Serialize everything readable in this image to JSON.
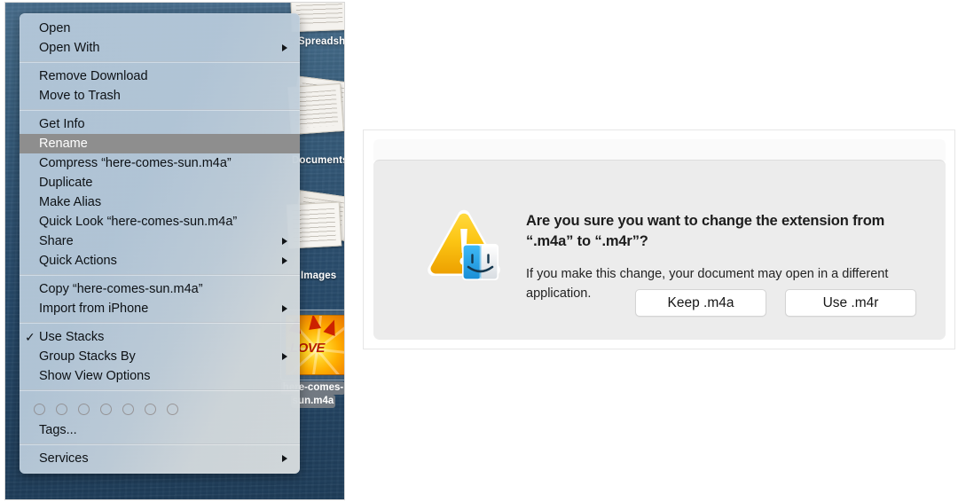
{
  "desktop": {
    "stacks": [
      {
        "label": "Spreadsheets"
      },
      {
        "label": "Documents"
      },
      {
        "label": "Images"
      }
    ],
    "selected_file": {
      "label_line1": "here-comes-",
      "label_line2": "sun.m4a",
      "cover_word": "LOVE"
    }
  },
  "context_menu": {
    "sections": [
      {
        "items": [
          {
            "label": "Open",
            "submenu": false,
            "checked": false,
            "highlighted": false
          },
          {
            "label": "Open With",
            "submenu": true,
            "checked": false,
            "highlighted": false
          }
        ]
      },
      {
        "items": [
          {
            "label": "Remove Download",
            "submenu": false,
            "checked": false,
            "highlighted": false
          },
          {
            "label": "Move to Trash",
            "submenu": false,
            "checked": false,
            "highlighted": false
          }
        ]
      },
      {
        "items": [
          {
            "label": "Get Info",
            "submenu": false,
            "checked": false,
            "highlighted": false
          },
          {
            "label": "Rename",
            "submenu": false,
            "checked": false,
            "highlighted": true
          },
          {
            "label": "Compress “here-comes-sun.m4a”",
            "submenu": false,
            "checked": false,
            "highlighted": false
          },
          {
            "label": "Duplicate",
            "submenu": false,
            "checked": false,
            "highlighted": false
          },
          {
            "label": "Make Alias",
            "submenu": false,
            "checked": false,
            "highlighted": false
          },
          {
            "label": "Quick Look “here-comes-sun.m4a”",
            "submenu": false,
            "checked": false,
            "highlighted": false
          },
          {
            "label": "Share",
            "submenu": true,
            "checked": false,
            "highlighted": false
          },
          {
            "label": "Quick Actions",
            "submenu": true,
            "checked": false,
            "highlighted": false
          }
        ]
      },
      {
        "items": [
          {
            "label": "Copy “here-comes-sun.m4a”",
            "submenu": false,
            "checked": false,
            "highlighted": false
          },
          {
            "label": "Import from iPhone",
            "submenu": true,
            "checked": false,
            "highlighted": false
          }
        ]
      },
      {
        "items": [
          {
            "label": "Use Stacks",
            "submenu": false,
            "checked": true,
            "highlighted": false
          },
          {
            "label": "Group Stacks By",
            "submenu": true,
            "checked": false,
            "highlighted": false
          },
          {
            "label": "Show View Options",
            "submenu": false,
            "checked": false,
            "highlighted": false
          }
        ]
      },
      {
        "tags": {
          "dot_count": 7,
          "label": "Tags..."
        }
      },
      {
        "items": [
          {
            "label": "Services",
            "submenu": true,
            "checked": false,
            "highlighted": false
          }
        ]
      }
    ]
  },
  "dialog": {
    "icon": "warning-triangle-finder-icon",
    "title": "Are you sure you want to change the extension from “.m4a” to “.m4r”?",
    "body": "If you make this change, your document may open in a different application.",
    "buttons": [
      {
        "label": "Keep .m4a",
        "default": false
      },
      {
        "label": "Use .m4r",
        "default": false
      }
    ]
  },
  "colors": {
    "menu_highlight": "#8e8e8e",
    "warning_yellow": "#f5b800",
    "finder_blue": "#2eaaf0",
    "desktop_blue": "#2d5070",
    "dialog_bg": "#ececec"
  }
}
